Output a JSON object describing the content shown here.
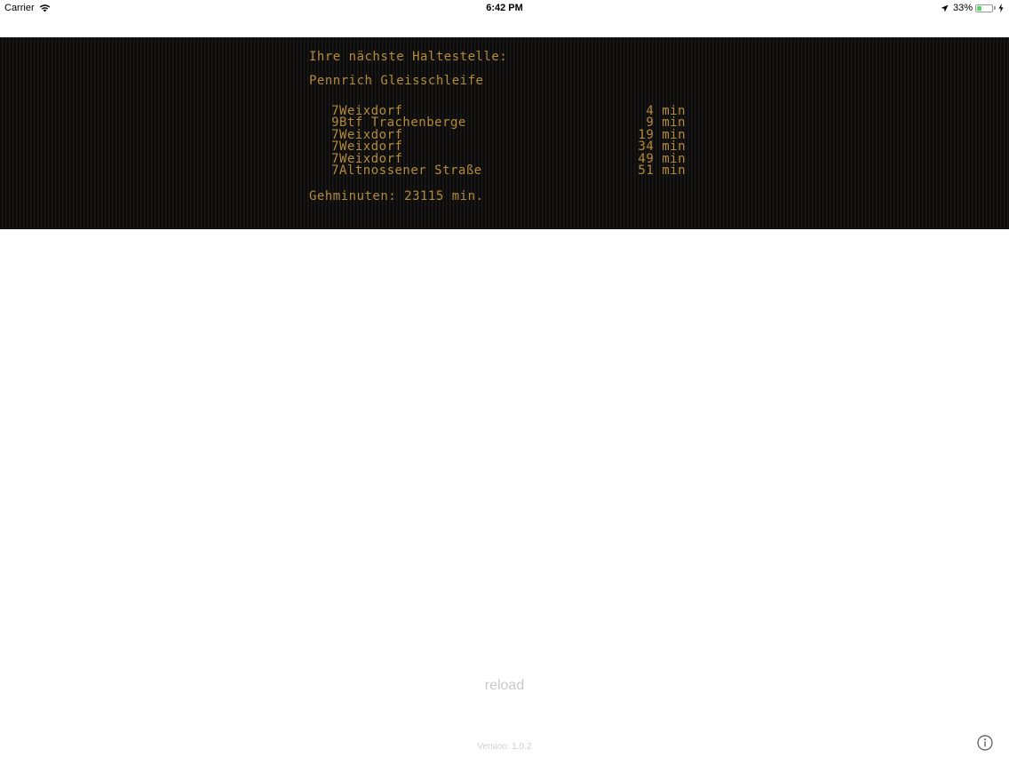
{
  "status_bar": {
    "carrier": "Carrier",
    "time": "6:42 PM",
    "battery_percent": "33%",
    "battery_level": 0.33,
    "icons": [
      "wifi-icon",
      "location-arrow-icon",
      "battery-icon",
      "charging-bolt-icon"
    ]
  },
  "board": {
    "heading": "Ihre nächste Haltestelle:",
    "stop_name": "Pennrich Gleisschleife",
    "departures": [
      {
        "line": "7",
        "destination": "Weixdorf",
        "time": "4 min"
      },
      {
        "line": "9",
        "destination": "Btf Trachenberge",
        "time": "9 min"
      },
      {
        "line": "7",
        "destination": "Weixdorf",
        "time": "19 min"
      },
      {
        "line": "7",
        "destination": "Weixdorf",
        "time": "34 min"
      },
      {
        "line": "7",
        "destination": "Weixdorf",
        "time": "49 min"
      },
      {
        "line": "7",
        "destination": "Altnossener Straße",
        "time": "51 min"
      }
    ],
    "walking": "Gehminuten: 23115 min."
  },
  "reload_label": "reload",
  "version": "Version: 1.0.2",
  "colors": {
    "board_text": "#b48a3c",
    "board_background": "#111111",
    "battery_fill": "#4cd964"
  }
}
